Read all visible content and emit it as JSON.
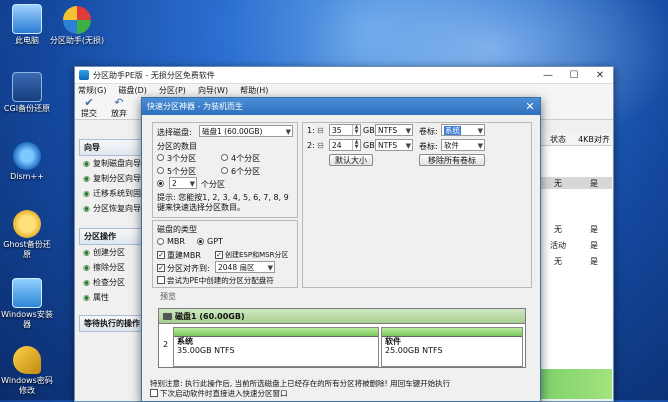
{
  "desktop": {
    "icons": [
      {
        "label": "此电脑"
      },
      {
        "label": "分区助手(无损)"
      },
      {
        "label": "CGI备份还原"
      },
      {
        "label": "Dism++"
      },
      {
        "label": "Ghost备份还原"
      },
      {
        "label": "Windows安装器"
      },
      {
        "label": "Windows密码修改"
      }
    ]
  },
  "main_window": {
    "title": "分区助手PE版 - 无损分区免费软件",
    "menu": [
      "常规(G)",
      "磁盘(D)",
      "分区(P)",
      "向导(W)",
      "帮助(H)"
    ],
    "toolbar": [
      "提交",
      "放弃"
    ],
    "left_panel": {
      "wizard_header": "向导",
      "wizard_items": [
        "复制磁盘向导",
        "复制分区向导",
        "迁移系统到固态",
        "分区恢复向导"
      ],
      "ops_header": "分区操作",
      "ops_items": [
        "创建分区",
        "擦除分区",
        "检查分区",
        "属性"
      ],
      "pending_header": "等待执行的操作"
    },
    "right_columns": {
      "headers": [
        "状态",
        "4KB对齐"
      ],
      "rows": [
        {
          "status": "无",
          "align": "是"
        },
        {
          "status": "无",
          "align": "是"
        },
        {
          "status": "活动",
          "align": "是"
        },
        {
          "status": "无",
          "align": "是"
        }
      ]
    }
  },
  "dialog": {
    "title": "快速分区神器 - 为装机而生",
    "select_disk_label": "选择磁盘:",
    "select_disk_value": "磁盘1 (60.00GB)",
    "partition_count_label": "分区的数目",
    "partition_options": [
      "3个分区",
      "4个分区",
      "5个分区",
      "6个分区"
    ],
    "custom_count_value": "2",
    "custom_count_suffix": "个分区",
    "hint": "提示: 您能按1, 2, 3, 4, 5, 6, 7, 8, 9键来快速选择分区数目。",
    "disk_type_label": "磁盘的类型",
    "disk_types": [
      "MBR",
      "GPT"
    ],
    "rebuild_mbr": "重建MBR",
    "create_esp": "创建ESP和MSR分区",
    "align_label": "分区对齐到:",
    "align_value": "2048 扇区",
    "try_pe": "尝试为PE中创建的分区分配盘符",
    "rows": [
      {
        "index": "1:",
        "size": "35",
        "unit": "GB",
        "fs": "NTFS",
        "label_caption": "卷标:",
        "label_value": "系统"
      },
      {
        "index": "2:",
        "size": "24",
        "unit": "GB",
        "fs": "NTFS",
        "label_caption": "卷标:",
        "label_value": "软件"
      }
    ],
    "default_size_button": "默认大小",
    "remove_labels_button": "移除所有卷标",
    "preview_label": "预览",
    "preview": {
      "disk_name": "磁盘1 (60.00GB)",
      "disk_index": "2",
      "partitions": [
        {
          "name": "系统",
          "info": "35.00GB NTFS"
        },
        {
          "name": "软件",
          "info": "25.00GB NTFS"
        }
      ]
    },
    "warning": "特别注意: 执行此操作后, 当前所选磁盘上已经存在的所有分区将被删除! 用回车键开始执行",
    "next_time": "下次启动软件时直接进入快速分区窗口"
  },
  "colors": {
    "accent": "#2e6fbd",
    "partition_bar": "#79c95c"
  }
}
